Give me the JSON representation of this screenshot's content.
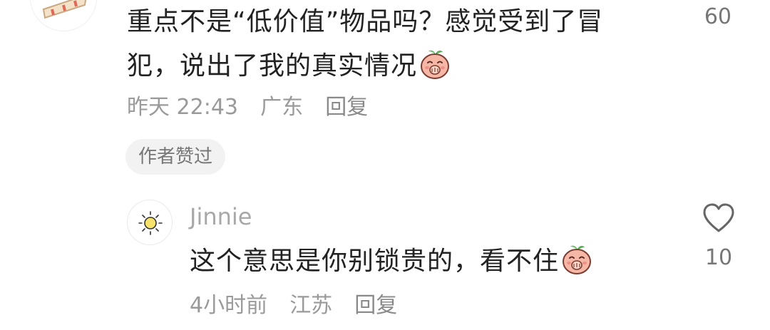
{
  "comment_top": {
    "text_line1": "重点不是“低价值”物品吗？感觉受到了冒",
    "text_line2": "犯，说出了我的真实情况",
    "emoji": "peach-covering-mouth-emoji",
    "time": "昨天 22:43",
    "location": "广东",
    "reply_label": "回复",
    "author_liked_badge": "作者赞过",
    "like_count": "60"
  },
  "comment_reply": {
    "username": "Jinnie",
    "avatar_icon": "sun-icon",
    "text": "这个意思是你别锁贵的，看不住",
    "emoji": "peach-covering-mouth-emoji",
    "time": "4小时前",
    "location": "江苏",
    "reply_label": "回复",
    "like_icon": "heart-outline-icon",
    "like_count": "10"
  },
  "colors": {
    "body_text": "#222222",
    "meta_text": "#9a9a9a",
    "username_text": "#a8a8a8",
    "badge_bg": "#f2f2f2",
    "emoji_peach": "#f6b7a6"
  }
}
